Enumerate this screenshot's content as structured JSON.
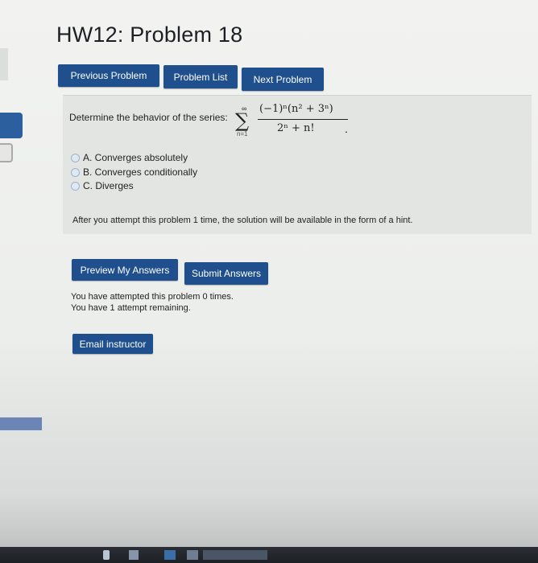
{
  "page": {
    "title": "HW12: Problem 18"
  },
  "nav": {
    "previous": "Previous Problem",
    "list": "Problem List",
    "next": "Next Problem"
  },
  "problem": {
    "prompt": "Determine the behavior of the series:",
    "formula": {
      "upper": "∞",
      "lower": "n=1",
      "numerator": "(−1)ⁿ(n² + 3ⁿ)",
      "denominator": "2ⁿ + n!",
      "terminator": "."
    },
    "options": [
      {
        "label": "A. Converges absolutely"
      },
      {
        "label": "B. Converges conditionally"
      },
      {
        "label": "C. Diverges"
      }
    ],
    "hint_note": "After you attempt this problem 1 time, the solution will be available in the form of a hint."
  },
  "actions": {
    "preview": "Preview My Answers",
    "submit": "Submit Answers",
    "email": "Email instructor"
  },
  "status": {
    "attempted": "You have attempted this problem 0 times.",
    "remaining": "You have 1 attempt remaining."
  },
  "colors": {
    "button_bg": "#1f4f8c",
    "button_text": "#ffffff",
    "page_bg": "#eceeec",
    "panel_bg": "#e3e5e3"
  }
}
